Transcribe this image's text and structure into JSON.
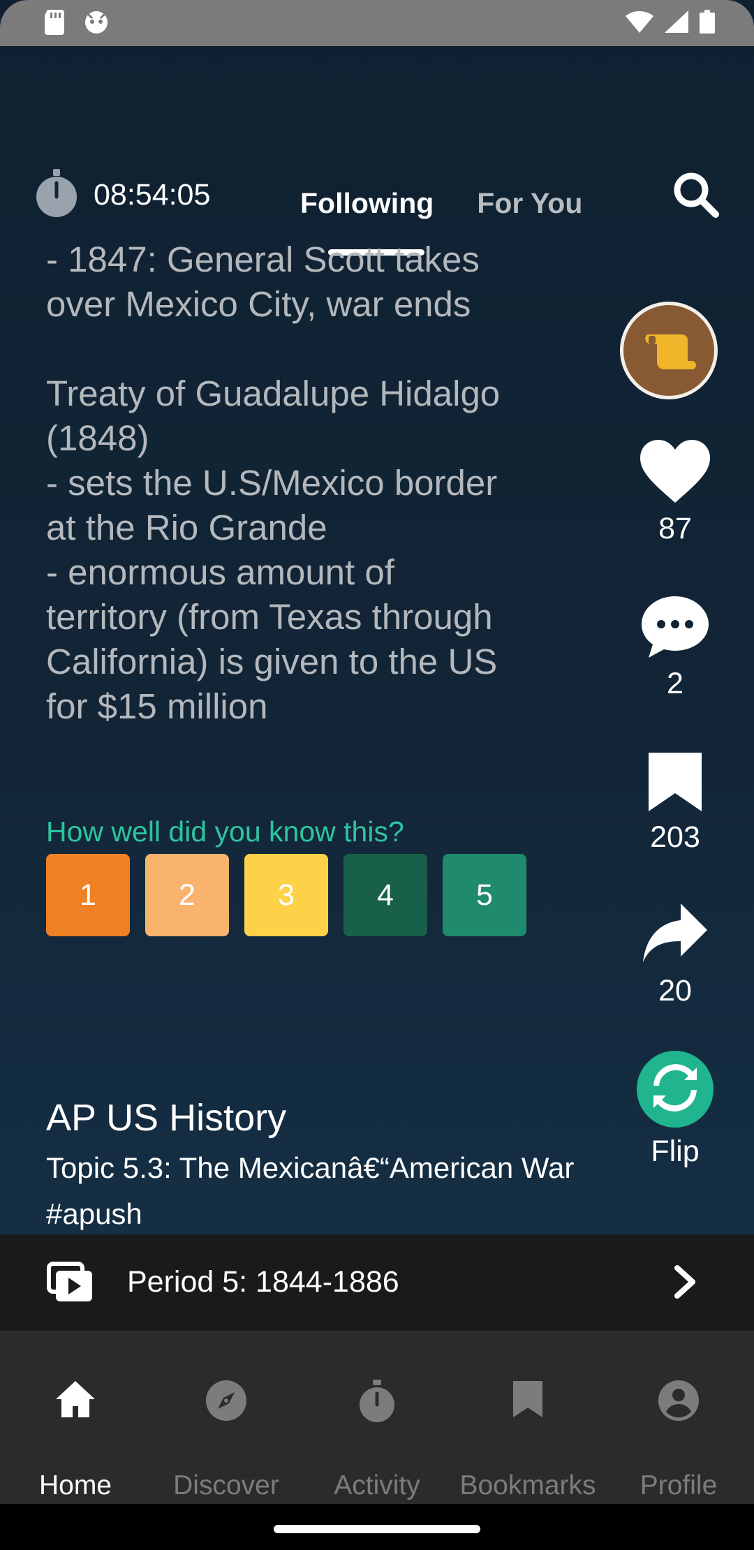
{
  "header": {
    "timer": "08:54:05",
    "tabs": [
      "Following",
      "For You"
    ]
  },
  "card": {
    "text": "- 1847: General Scott takes\nover Mexico City, war ends\n\nTreaty of Guadalupe Hidalgo\n(1848)\n- sets the U.S/Mexico border\nat the Rio Grande\n- enormous amount of\nterritory (from Texas through\nCalifornia) is given to the US\nfor $15 million"
  },
  "rating": {
    "label": "How well did you know this?",
    "options": [
      {
        "label": "1",
        "color": "#f08024"
      },
      {
        "label": "2",
        "color": "#f8b36d"
      },
      {
        "label": "3",
        "color": "#fed248"
      },
      {
        "label": "4",
        "color": "#19604a"
      },
      {
        "label": "5",
        "color": "#1f8a6c"
      }
    ]
  },
  "rail": {
    "likes": "87",
    "comments": "2",
    "bookmarks": "203",
    "shares": "20",
    "flip_label": "Flip"
  },
  "info": {
    "course": "AP US History",
    "topic": "Topic 5.3: The Mexicanâ€“American War #apush"
  },
  "playlist": {
    "label": "Period 5: 1844-1886"
  },
  "nav": {
    "items": [
      "Home",
      "Discover",
      "Activity",
      "Bookmarks",
      "Profile"
    ],
    "active": "Home"
  },
  "colors": {
    "accent": "#2ec4a0",
    "flip": "#20b58e",
    "avatar_bg": "#875a34",
    "avatar_icon": "#f0b52a"
  }
}
